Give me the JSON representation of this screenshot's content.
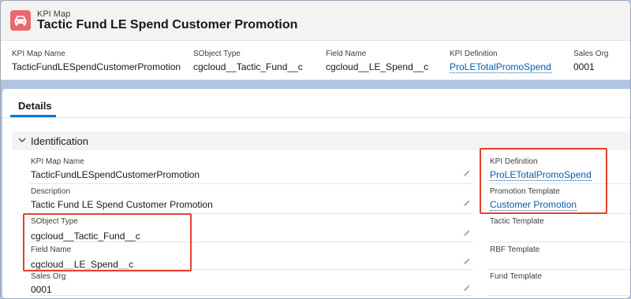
{
  "header": {
    "object_type": "KPI Map",
    "title": "Tactic Fund LE Spend Customer Promotion",
    "fields": [
      {
        "label": "KPI Map Name",
        "value": "TacticFundLESpendCustomerPromotion"
      },
      {
        "label": "SObject Type",
        "value": "cgcloud__Tactic_Fund__c"
      },
      {
        "label": "Field Name",
        "value": "cgcloud__LE_Spend__c"
      },
      {
        "label": "KPI Definition",
        "value": "ProLETotalPromoSpend"
      },
      {
        "label": "Sales Org",
        "value": "0001"
      }
    ]
  },
  "tabs": {
    "details": "Details"
  },
  "section": {
    "title": "Identification"
  },
  "left_fields": [
    {
      "label": "KPI Map Name",
      "value": "TacticFundLESpendCustomerPromotion"
    },
    {
      "label": "Description",
      "value": "Tactic Fund LE Spend Customer Promotion"
    },
    {
      "label": "SObject Type",
      "value": "cgcloud__Tactic_Fund__c"
    },
    {
      "label": "Field Name",
      "value": "cgcloud__LE_Spend__c"
    },
    {
      "label": "Sales Org",
      "value": "0001"
    }
  ],
  "right_fields": [
    {
      "label": "KPI Definition",
      "value": "ProLETotalPromoSpend"
    },
    {
      "label": "Promotion Template",
      "value": "Customer Promotion"
    },
    {
      "label": "Tactic Template",
      "value": ""
    },
    {
      "label": "RBF Template",
      "value": ""
    },
    {
      "label": "Fund Template",
      "value": ""
    }
  ],
  "icons": {
    "object": "car-icon",
    "section": "chevron-down-icon",
    "edit": "pencil-icon"
  },
  "colors": {
    "accent": "#0176d3",
    "link": "#0b5cab",
    "highlight": "#e3412f",
    "object_icon": "#e9696e"
  }
}
